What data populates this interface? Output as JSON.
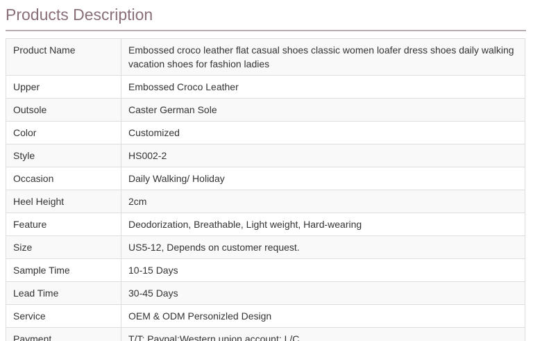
{
  "section": {
    "title": "Products Description"
  },
  "specs": [
    {
      "label": "Product Name",
      "value": "Embossed croco leather flat casual shoes classic women loafer dress shoes daily walking vacation shoes for fashion ladies"
    },
    {
      "label": "Upper",
      "value": "Embossed Croco Leather"
    },
    {
      "label": "Outsole",
      "value": "Caster German Sole"
    },
    {
      "label": "Color",
      "value": "Customized"
    },
    {
      "label": "Style",
      "value": "HS002-2"
    },
    {
      "label": "Occasion",
      "value": "Daily Walking/ Holiday"
    },
    {
      "label": "Heel Height",
      "value": "2cm"
    },
    {
      "label": "Feature",
      "value": "Deodorization, Breathable, Light weight, Hard-wearing"
    },
    {
      "label": "Size",
      "value": "US5-12, Depends on customer request."
    },
    {
      "label": "Sample Time",
      "value": "10-15 Days"
    },
    {
      "label": "Lead Time",
      "value": "30-45 Days"
    },
    {
      "label": "Service",
      "value": "OEM & ODM Personizled Design"
    },
    {
      "label": "Payment",
      "value": "T/T; Paypal;Western union account; L/C"
    }
  ]
}
